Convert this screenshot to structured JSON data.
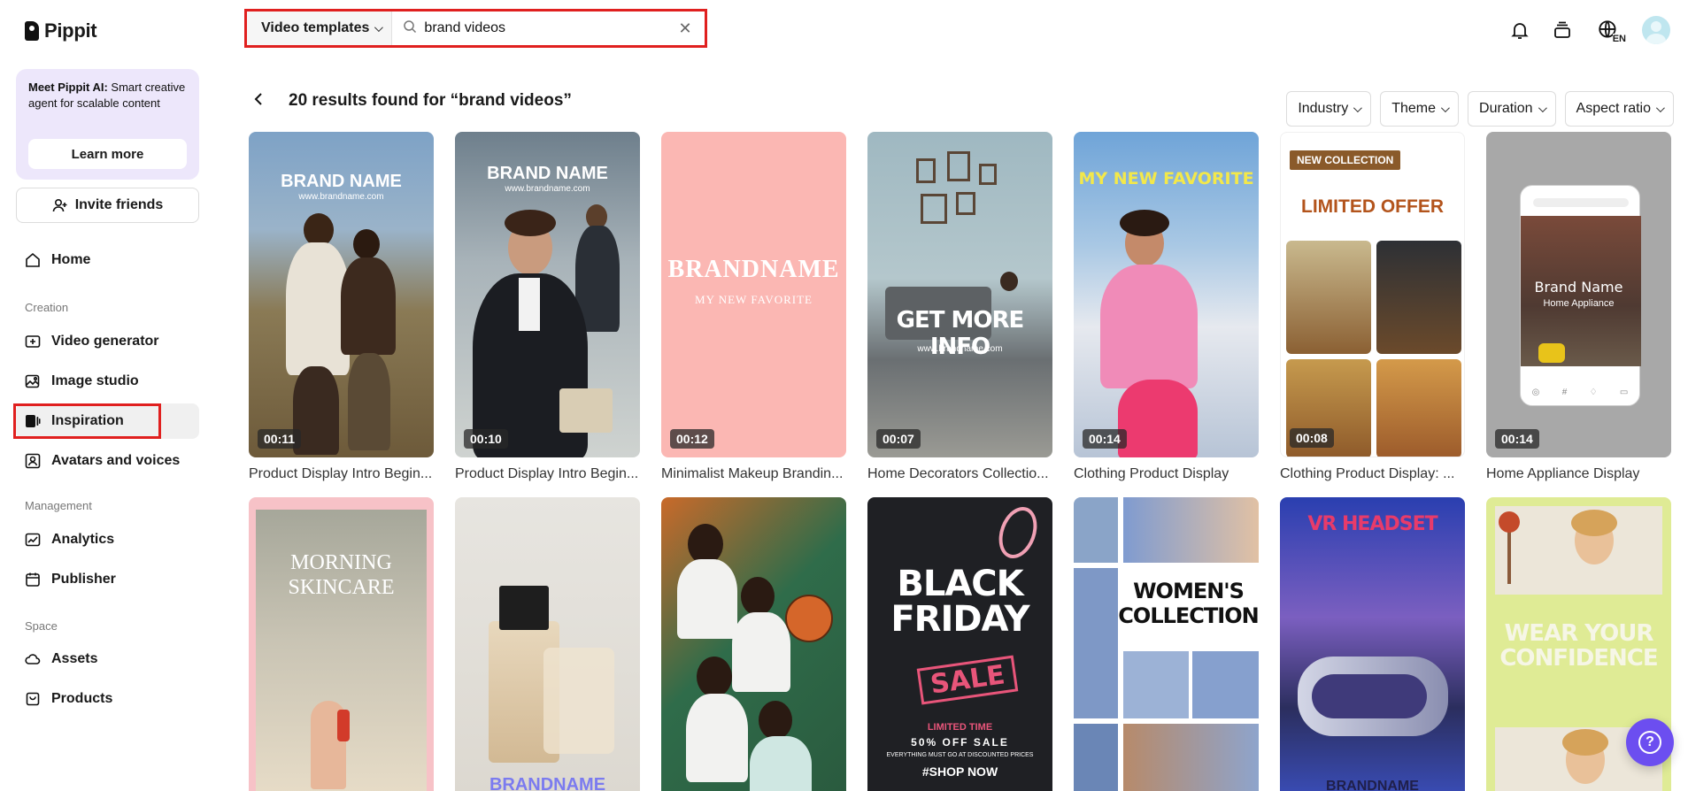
{
  "app": {
    "name": "Pippit"
  },
  "promo": {
    "title": "Meet Pippit AI:",
    "body": " Smart creative agent for scalable content",
    "button": "Learn more"
  },
  "invite": {
    "label": "Invite friends"
  },
  "nav": {
    "home": "Home",
    "section_creation": "Creation",
    "video_generator": "Video generator",
    "image_studio": "Image studio",
    "inspiration": "Inspiration",
    "avatars_voices": "Avatars and voices",
    "section_management": "Management",
    "analytics": "Analytics",
    "publisher": "Publisher",
    "section_space": "Space",
    "assets": "Assets",
    "products": "Products"
  },
  "search": {
    "category": "Video templates",
    "value": "brand videos"
  },
  "topbar": {
    "lang": "EN"
  },
  "results": {
    "title": "20 results found for “brand videos”"
  },
  "filters": [
    "Industry",
    "Theme",
    "Duration",
    "Aspect ratio"
  ],
  "cards_row1": [
    {
      "title": "Product Display Intro Begin...",
      "duration": "00:11",
      "overlay": "BRAND NAME",
      "overlay_sub": "www.brandname.com"
    },
    {
      "title": "Product Display Intro Begin...",
      "duration": "00:10",
      "overlay": "BRAND NAME",
      "overlay_sub": "www.brandname.com"
    },
    {
      "title": "Minimalist Makeup Brandin...",
      "duration": "00:12",
      "overlay": "BRANDNAME",
      "overlay_sub": "MY NEW FAVORITE"
    },
    {
      "title": "Home Decorators Collectio...",
      "duration": "00:07",
      "overlay": "GET MORE INFO",
      "overlay_sub": "www.brandname.com"
    },
    {
      "title": "Clothing Product Display",
      "duration": "00:14",
      "overlay": "MY NEW FAVORITE",
      "overlay_sub": ""
    },
    {
      "title": "Clothing Product Display: ...",
      "duration": "00:08",
      "overlay": "LIMITED OFFER",
      "overlay_sub": "NEW COLLECTION"
    },
    {
      "title": "Home Appliance Display",
      "duration": "00:14",
      "overlay": "Brand Name",
      "overlay_sub": "Home Appliance"
    }
  ],
  "cards_row2": [
    {
      "overlay": "MORNING SKINCARE"
    },
    {
      "overlay": "BRANDNAME"
    },
    {
      "overlay": ""
    },
    {
      "overlay": "BLACK FRIDAY",
      "badge": "SALE",
      "sub1": "LIMITED TIME",
      "sub2": "50% OFF SALE",
      "sub3": "EVERYTHING MUST GO AT DISCOUNTED PRICES",
      "sub4": "#SHOP NOW"
    },
    {
      "overlay": "WOMEN'S COLLECTION"
    },
    {
      "overlay": "VR HEADSET",
      "sub1": "BRANDNAME"
    },
    {
      "overlay": "WEAR YOUR CONFIDENCE"
    }
  ],
  "icons": {
    "bell": "bell-icon",
    "stack": "stack-icon",
    "globe": "globe-lang-icon",
    "help": "help-icon"
  },
  "colors": {
    "accent": "#6c4ef0",
    "highlight": "#e0201f",
    "promo_bg": "#ede7fb"
  }
}
